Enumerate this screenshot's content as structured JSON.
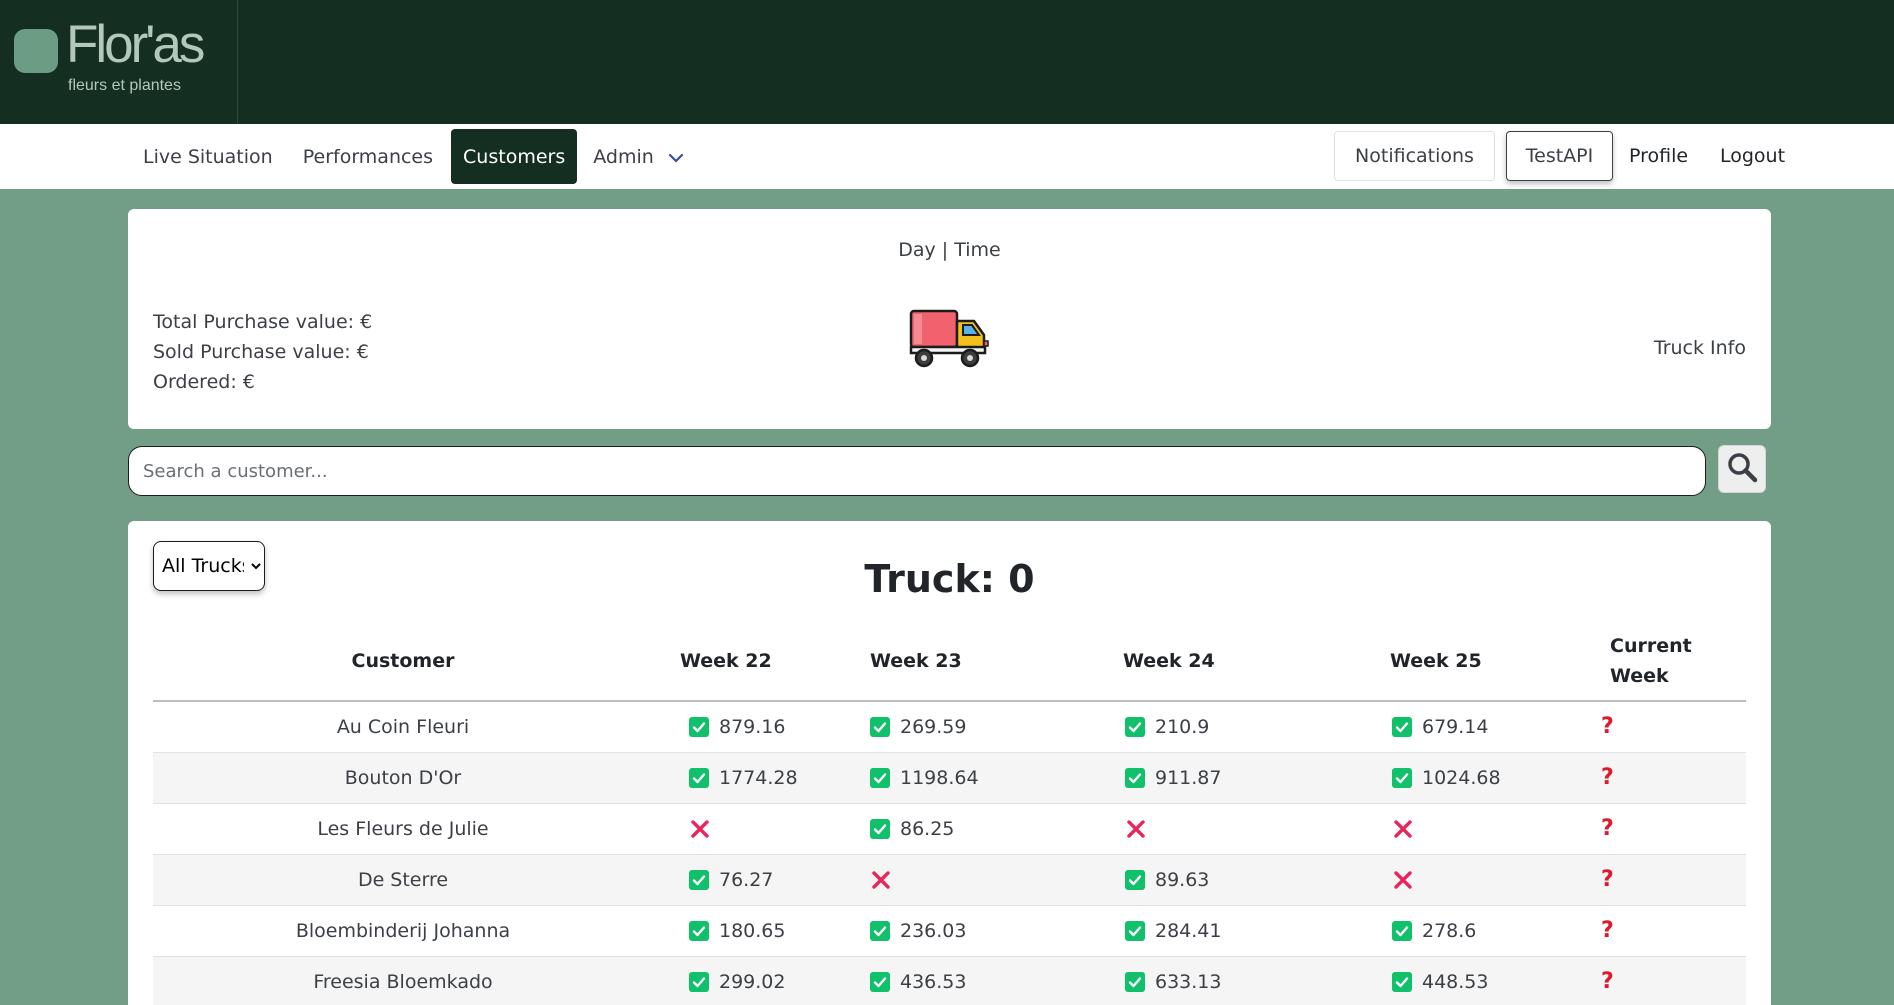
{
  "brand": {
    "name": "Flor'as",
    "tagline": "fleurs et plantes"
  },
  "nav": {
    "items": [
      "Live Situation",
      "Performances",
      "Customers",
      "Admin"
    ],
    "active": "Customers",
    "right": {
      "notifications": "Notifications",
      "test_api": "TestAPI",
      "profile": "Profile",
      "logout": "Logout"
    }
  },
  "summary": {
    "day_time": "Day | Time",
    "total_purchase": "Total Purchase value: €",
    "sold_purchase": "Sold Purchase value: €",
    "ordered": "Ordered: €",
    "truck_info": "Truck Info"
  },
  "search": {
    "placeholder": "Search a customer..."
  },
  "filter": {
    "selected": "All Trucks"
  },
  "table": {
    "title": "Truck: 0",
    "headers": [
      "Customer",
      "Week 22",
      "Week 23",
      "Week 24",
      "Week 25",
      "Current Week"
    ],
    "rows": [
      {
        "customer": "Au Coin Fleuri",
        "weeks": [
          "879.16",
          "269.59",
          "210.9",
          "679.14"
        ]
      },
      {
        "customer": "Bouton D'Or",
        "weeks": [
          "1774.28",
          "1198.64",
          "911.87",
          "1024.68"
        ]
      },
      {
        "customer": "Les Fleurs de Julie",
        "weeks": [
          null,
          "86.25",
          null,
          null
        ]
      },
      {
        "customer": "De Sterre",
        "weeks": [
          "76.27",
          null,
          "89.63",
          null
        ]
      },
      {
        "customer": "Bloembinderij Johanna",
        "weeks": [
          "180.65",
          "236.03",
          "284.41",
          "278.6"
        ]
      },
      {
        "customer": "Freesia Bloemkado",
        "weeks": [
          "299.02",
          "436.53",
          "633.13",
          "448.53"
        ]
      }
    ],
    "current_week_symbol": "?"
  },
  "colors": {
    "topbar": "#142e22",
    "background": "#729e88",
    "active_nav": "#142e22",
    "check": "#11c06a",
    "cross": "#e8265e",
    "question": "#e0182c"
  },
  "icons": {
    "search": "search-icon",
    "truck": "truck-icon",
    "check": "check-icon",
    "cross": "cross-icon",
    "question": "question-icon",
    "chevron": "chevron-down-icon"
  }
}
